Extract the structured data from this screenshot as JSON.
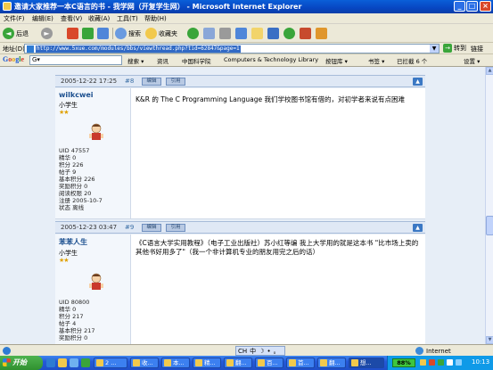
{
  "window": {
    "title": "邀请大家推荐一本C语言的书 - 我学网（开复学生网） - Microsoft Internet Explorer",
    "min": "_",
    "max": "□",
    "close": "×"
  },
  "menu": [
    "文件(F)",
    "编辑(E)",
    "查看(V)",
    "收藏(A)",
    "工具(T)",
    "帮助(H)"
  ],
  "toolbar": {
    "back": "后退",
    "back_icon": "◄",
    "forward_icon": "►",
    "search": "搜索",
    "favorites": "收藏夹"
  },
  "address": {
    "label": "地址(D)",
    "url": "http://www.5xue.com/modules/bbs/viewthread.php?tid=62847&page=1",
    "go": "转到",
    "links": "链接"
  },
  "google": {
    "logo": [
      "G",
      "o",
      "o",
      "g",
      "l",
      "e"
    ],
    "search_value": "G▾",
    "items": [
      "搜索 ▾",
      "资讯",
      "中国科学院",
      "Computers & Technology Library",
      "按钮库 ▾",
      "书签 ▾",
      "已拦截 6 个",
      "设置 ▾"
    ]
  },
  "posts": [
    {
      "date": "2005-12-22 17:25",
      "floor": "#8",
      "username": "wilkcwei",
      "rank": "小学生",
      "stars": "★★",
      "stats": [
        "UID 47557",
        "精华  0",
        "积分  226",
        "帖子  9",
        "基本积分  226",
        "奖励积分  0",
        "阅读权限  20",
        "注册  2005-10-7",
        "状态  离线"
      ],
      "content": "K&R 的   The C Programming Language 我们学校图书馆有借的，对初学者来说有点困难"
    },
    {
      "date": "2005-12-23 03:47",
      "floor": "#9",
      "username": "苯苯人生",
      "rank": "小学生",
      "stars": "★★",
      "stats": [
        "UID 80800",
        "精华  0",
        "积分  217",
        "帖子  4",
        "基本积分  217",
        "奖励积分  0"
      ],
      "content": "《C语言大学实用教程》（电子工业出版社）苏小红等编 我上大学用的就是这本书 \"比市场上卖的其他书好用多了\"（我一个非计算机专业的朋友用完之后的话）"
    }
  ],
  "post_buttons": {
    "edit": "编辑",
    "quote": "引用",
    "top": "▲"
  },
  "status": {
    "ime": [
      "CH",
      "中",
      "☽",
      "•",
      "。"
    ],
    "zone": "Internet"
  },
  "taskbar": {
    "start": "开始",
    "tasks": [
      "2 ...",
      "收...",
      "本...",
      "精...",
      "翻...",
      "百...",
      "首...",
      "翻...",
      "想..."
    ],
    "battery": "88%",
    "clock": "10:13"
  },
  "colors": {
    "titlebar": "#0746c2",
    "page_bg": "#e7eef7",
    "username": "#1b4f8f"
  }
}
